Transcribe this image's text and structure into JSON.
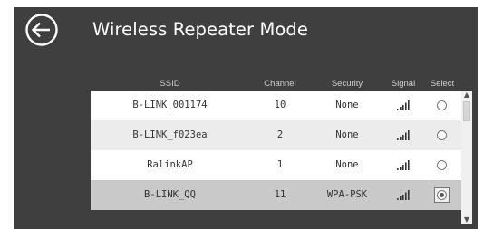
{
  "header": {
    "title": "Wireless Repeater Mode",
    "back_icon": "back-arrow-circle-icon"
  },
  "table": {
    "columns": [
      "SSID",
      "Channel",
      "Security",
      "Signal",
      "Select"
    ],
    "rows": [
      {
        "ssid": "B-LINK_001174",
        "channel": "10",
        "security": "None",
        "signal": "signal-bars-icon",
        "selected": false,
        "bg": "#ffffff"
      },
      {
        "ssid": "B-LINK_f023ea",
        "channel": "2",
        "security": "None",
        "signal": "signal-bars-icon",
        "selected": false,
        "bg": "#ececec"
      },
      {
        "ssid": "RalinkAP",
        "channel": "1",
        "security": "None",
        "signal": "signal-bars-icon",
        "selected": false,
        "bg": "#ffffff"
      },
      {
        "ssid": "B-LINK_QQ",
        "channel": "11",
        "security": "WPA-PSK",
        "signal": "signal-bars-icon",
        "selected": true,
        "bg": "#c9c9c9"
      }
    ]
  },
  "colors": {
    "panel": "#3f3f3f",
    "header_text": "#cfcfcf",
    "title_text": "#ffffff",
    "selected_row": "#c9c9c9",
    "alt_row": "#ececec"
  }
}
